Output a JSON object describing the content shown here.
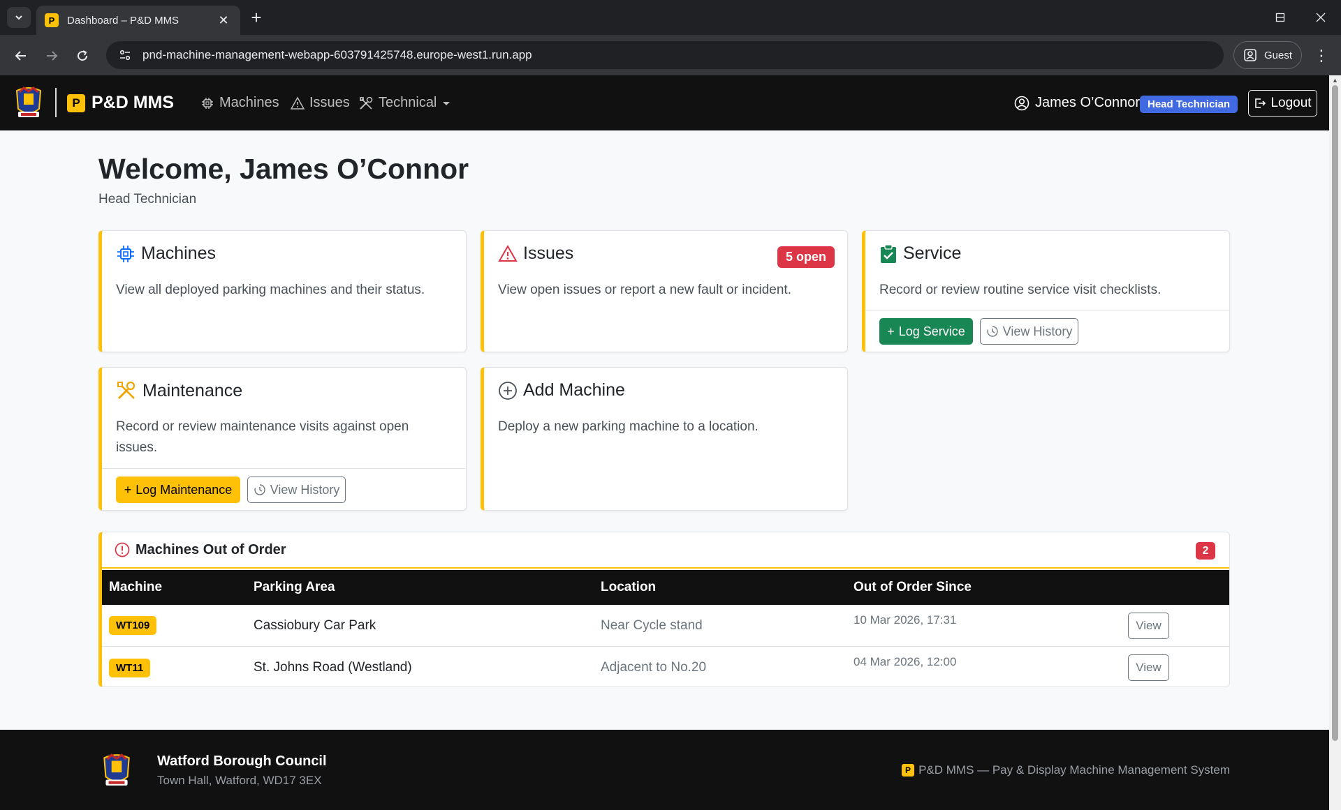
{
  "browser": {
    "tab_title": "Dashboard – P&D MMS",
    "tab_favicon_letter": "P",
    "url": "pnd-machine-management-webapp-603791425748.europe-west1.run.app",
    "profile_label": "Guest"
  },
  "nav": {
    "brand_letter": "P",
    "brand": "P&D MMS",
    "links": {
      "machines": "Machines",
      "issues": "Issues",
      "technical": "Technical"
    },
    "user_name": "James O’Connor",
    "role_badge": "Head Technician",
    "logout": "Logout"
  },
  "welcome": {
    "heading": "Welcome, James O’Connor",
    "role": "Head Technician"
  },
  "cards": {
    "machines": {
      "title": "Machines",
      "text": "View all deployed parking machines and their status."
    },
    "issues": {
      "title": "Issues",
      "badge": "5 open",
      "text": "View open issues or report a new fault or incident."
    },
    "service": {
      "title": "Service",
      "text": "Record or review routine service visit checklists.",
      "primary": "Log Service",
      "secondary": "View History"
    },
    "maintenance": {
      "title": "Maintenance",
      "text": "Record or review maintenance visits against open issues.",
      "primary": "Log Maintenance",
      "secondary": "View History"
    },
    "add_machine": {
      "title": "Add Machine",
      "text": "Deploy a new parking machine to a location."
    }
  },
  "out_of_order": {
    "title": "Machines Out of Order",
    "count": "2",
    "columns": [
      "Machine",
      "Parking Area",
      "Location",
      "Out of Order Since"
    ],
    "rows": [
      {
        "machine": "WT109",
        "area": "Cassiobury Car Park",
        "location": "Near Cycle stand",
        "since": "10 Mar 2026, 17:31",
        "action": "View"
      },
      {
        "machine": "WT11",
        "area": "St. Johns Road (Westland)",
        "location": "Adjacent to No.20",
        "since": "04 Mar 2026, 12:00",
        "action": "View"
      }
    ]
  },
  "footer": {
    "org": "Watford Borough Council",
    "address": "Town Hall, Watford, WD17 3EX",
    "badge_letter": "P",
    "system": "P&D MMS — Pay & Display Machine Management System"
  },
  "colors": {
    "accent": "#ffc107",
    "danger": "#dc3545",
    "success": "#198754",
    "role_badge": "#4169e1",
    "navbar": "#111111"
  },
  "icons": [
    "chevron-down-icon",
    "close-icon",
    "plus-icon",
    "minimize-icon",
    "maximize-icon",
    "back-icon",
    "forward-icon",
    "reload-icon",
    "site-info-icon",
    "profile-icon",
    "more-icon",
    "chip-icon",
    "warning-icon",
    "tools-icon",
    "user-circle-icon",
    "logout-icon",
    "clipboard-check-icon",
    "plus-circle-icon",
    "clock-history-icon",
    "exclamation-circle-icon"
  ]
}
